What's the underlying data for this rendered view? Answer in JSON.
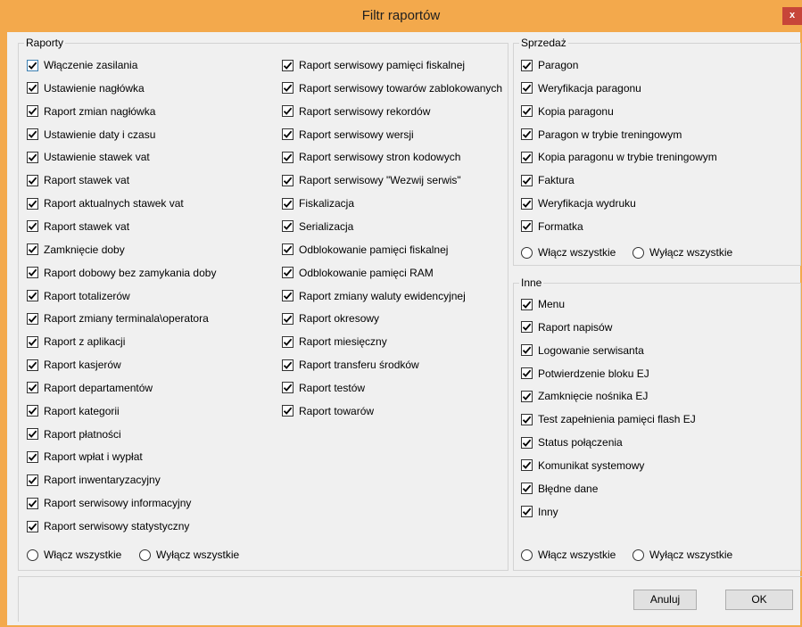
{
  "window": {
    "title": "Filtr raportów",
    "close_glyph": "x"
  },
  "groups": {
    "raporty": {
      "legend": "Raporty",
      "col1": [
        "Włączenie zasilania",
        "Ustawienie nagłówka",
        "Raport zmian nagłówka",
        "Ustawienie daty i czasu",
        "Ustawienie stawek vat",
        "Raport stawek vat",
        "Raport aktualnych stawek vat",
        "Raport stawek vat",
        "Zamknięcie doby",
        "Raport dobowy bez zamykania doby",
        "Raport totalizerów",
        "Raport zmiany terminala\\operatora",
        "Raport z aplikacji",
        "Raport kasjerów",
        "Raport departamentów",
        "Raport kategorii",
        "Raport płatności",
        "Raport wpłat i wypłat",
        "Raport inwentaryzacyjny",
        "Raport serwisowy informacyjny",
        "Raport serwisowy statystyczny"
      ],
      "col2": [
        "Raport serwisowy pamięci fiskalnej",
        "Raport serwisowy towarów zablokowanych",
        "Raport serwisowy rekordów",
        "Raport serwisowy wersji",
        "Raport serwisowy stron kodowych",
        "Raport serwisowy \"Wezwij serwis\"",
        "Fiskalizacja",
        "Serializacja",
        "Odblokowanie pamięci fiskalnej",
        "Odblokowanie pamięci RAM",
        "Raport zmiany waluty ewidencyjnej",
        "Raport okresowy",
        "Raport miesięczny",
        "Raport transferu środków",
        "Raport testów",
        "Raport towarów"
      ],
      "radio_on": "Włącz wszystkie",
      "radio_off": "Wyłącz wszystkie"
    },
    "sprzedaz": {
      "legend": "Sprzedaż",
      "items": [
        "Paragon",
        "Weryfikacja paragonu",
        "Kopia paragonu",
        "Paragon w trybie treningowym",
        "Kopia paragonu w trybie treningowym",
        "Faktura",
        "Weryfikacja wydruku",
        "Formatka"
      ],
      "radio_on": "Włącz wszystkie",
      "radio_off": "Wyłącz wszystkie"
    },
    "inne": {
      "legend": "Inne",
      "items": [
        "Menu",
        "Raport napisów",
        "Logowanie serwisanta",
        "Potwierdzenie bloku EJ",
        "Zamknięcie nośnika EJ",
        "Test zapełnienia pamięci flash EJ",
        "Status połączenia",
        "Komunikat systemowy",
        "Błędne dane",
        "Inny"
      ],
      "radio_on": "Włącz wszystkie",
      "radio_off": "Wyłącz wszystkie"
    }
  },
  "buttons": {
    "cancel": "Anuluj",
    "ok": "OK"
  },
  "colors": {
    "accent": "#f3a94c",
    "close": "#c74539",
    "check_focus": "#3c7fb1"
  }
}
